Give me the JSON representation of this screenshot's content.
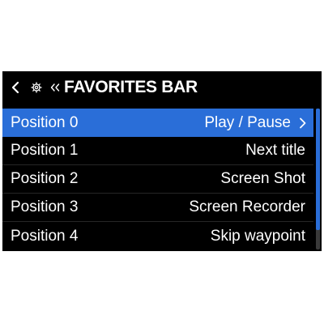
{
  "header": {
    "title": "FAVORITES BAR",
    "icons": [
      "chevron-left-icon",
      "gear-icon",
      "double-chevron-left-icon"
    ]
  },
  "list": {
    "items": [
      {
        "label": "Position 0",
        "value": "Play / Pause",
        "selected": true
      },
      {
        "label": "Position 1",
        "value": "Next title",
        "selected": false
      },
      {
        "label": "Position 2",
        "value": "Screen Shot",
        "selected": false
      },
      {
        "label": "Position 3",
        "value": "Screen Recorder",
        "selected": false
      },
      {
        "label": "Position 4",
        "value": "Skip waypoint",
        "selected": false
      }
    ]
  },
  "colors": {
    "background": "#000000",
    "accent": "#2a6ed8",
    "text": "#ffffff",
    "scroll_track": "#3a3a3a"
  },
  "scroll": {
    "visible_fraction": 0.86,
    "position_fraction": 0.0
  }
}
